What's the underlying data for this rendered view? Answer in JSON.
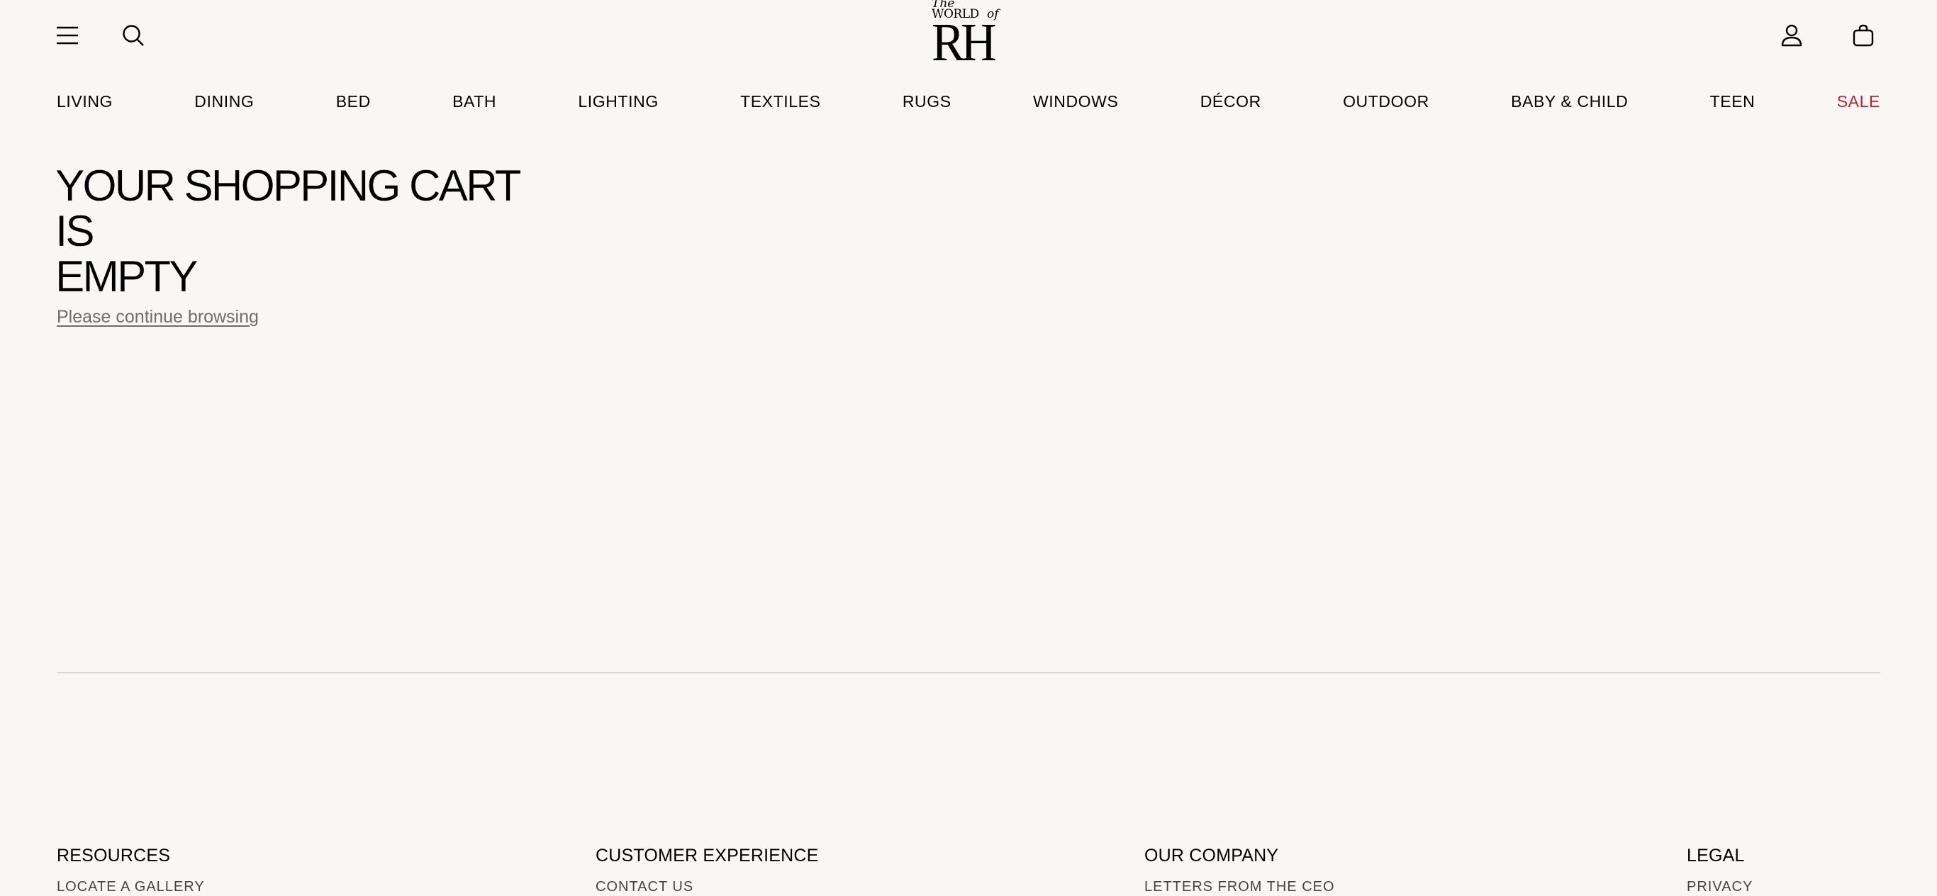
{
  "header": {
    "menu_icon": "hamburger-menu-icon",
    "search_icon": "search-icon",
    "account_icon": "user-account-icon",
    "cart_icon": "shopping-bag-icon",
    "logo": {
      "the": "The",
      "world": "WORLD",
      "of": "of",
      "rh": "RH"
    }
  },
  "nav": {
    "items": [
      {
        "label": "LIVING"
      },
      {
        "label": "DINING"
      },
      {
        "label": "BED"
      },
      {
        "label": "BATH"
      },
      {
        "label": "LIGHTING"
      },
      {
        "label": "TEXTILES"
      },
      {
        "label": "RUGS"
      },
      {
        "label": "WINDOWS"
      },
      {
        "label": "DÉCOR"
      },
      {
        "label": "OUTDOOR"
      },
      {
        "label": "BABY & CHILD"
      },
      {
        "label": "TEEN"
      },
      {
        "label": "SALE"
      }
    ],
    "sale_color": "#b8232f"
  },
  "main": {
    "title_line1": "YOUR SHOPPING CART IS",
    "title_line2": "EMPTY",
    "continue_link": "Please continue browsing"
  },
  "footer": {
    "columns": [
      {
        "heading": "RESOURCES",
        "first_link": "LOCATE A GALLERY"
      },
      {
        "heading": "CUSTOMER EXPERIENCE",
        "first_link": "CONTACT US"
      },
      {
        "heading": "OUR COMPANY",
        "first_link": "LETTERS FROM THE CEO"
      },
      {
        "heading": "LEGAL",
        "first_link": "PRIVACY"
      }
    ]
  },
  "colors": {
    "background": "#f9f7f4",
    "text": "#000000",
    "link_muted": "#6e6e6e",
    "divider": "#d9d7d3",
    "sale": "#b8232f"
  }
}
